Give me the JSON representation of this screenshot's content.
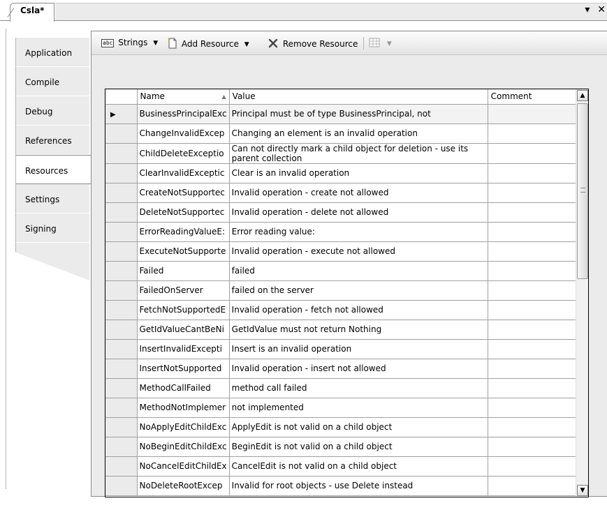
{
  "document_tab": {
    "title": "Csla*",
    "dropdown_glyph": "▾",
    "close_glyph": "✕"
  },
  "project_tabs": [
    {
      "label": "Application",
      "active": false
    },
    {
      "label": "Compile",
      "active": false
    },
    {
      "label": "Debug",
      "active": false
    },
    {
      "label": "References",
      "active": false
    },
    {
      "label": "Resources",
      "active": true
    },
    {
      "label": "Settings",
      "active": false
    },
    {
      "label": "Signing",
      "active": false
    }
  ],
  "toolbar": {
    "strings_icon": "abc",
    "strings_label": "Strings",
    "add_resource_label": "Add Resource",
    "remove_resource_label": "Remove Resource",
    "icons": {
      "strings": "abc-icon",
      "add": "add-resource-icon",
      "remove": "remove-icon",
      "views": "views-icon"
    }
  },
  "grid": {
    "columns": {
      "name": "Name",
      "value": "Value",
      "comment": "Comment"
    },
    "current_row_glyph": "▶",
    "rows": [
      {
        "name": "BusinessPrincipalExc",
        "value": "Principal must be of type BusinessPrincipal, not",
        "comment": ""
      },
      {
        "name": "ChangeInvalidExcep",
        "value": "Changing an element is an invalid operation",
        "comment": ""
      },
      {
        "name": "ChildDeleteExceptio",
        "value": "Can not directly mark a child object for deletion - use its parent collection",
        "comment": ""
      },
      {
        "name": "ClearInvalidExceptic",
        "value": "Clear is an invalid operation",
        "comment": ""
      },
      {
        "name": "CreateNotSupportec",
        "value": "Invalid operation - create not allowed",
        "comment": ""
      },
      {
        "name": "DeleteNotSupportec",
        "value": "Invalid operation - delete not allowed",
        "comment": ""
      },
      {
        "name": "ErrorReadingValueE:",
        "value": "Error reading value:",
        "comment": ""
      },
      {
        "name": "ExecuteNotSupporte",
        "value": "Invalid operation - execute not allowed",
        "comment": ""
      },
      {
        "name": "Failed",
        "value": "failed",
        "comment": ""
      },
      {
        "name": "FailedOnServer",
        "value": "failed on the server",
        "comment": ""
      },
      {
        "name": "FetchNotSupportedE",
        "value": "Invalid operation - fetch not allowed",
        "comment": ""
      },
      {
        "name": "GetIdValueCantBeNi",
        "value": "GetIdValue must not return Nothing",
        "comment": ""
      },
      {
        "name": "InsertInvalidExcepti",
        "value": "Insert is an invalid operation",
        "comment": ""
      },
      {
        "name": "InsertNotSupported",
        "value": "Invalid operation - insert not allowed",
        "comment": ""
      },
      {
        "name": "MethodCallFailed",
        "value": "method call failed",
        "comment": ""
      },
      {
        "name": "MethodNotImplemer",
        "value": "not implemented",
        "comment": ""
      },
      {
        "name": "NoApplyEditChildExc",
        "value": "ApplyEdit is not valid on a child object",
        "comment": ""
      },
      {
        "name": "NoBeginEditChildExc",
        "value": "BeginEdit is not valid on a child object",
        "comment": ""
      },
      {
        "name": "NoCancelEditChildEx",
        "value": "CancelEdit is not valid on a child object",
        "comment": ""
      },
      {
        "name": "NoDeleteRootExcep",
        "value": "Invalid for root objects - use Delete instead",
        "comment": ""
      }
    ]
  }
}
